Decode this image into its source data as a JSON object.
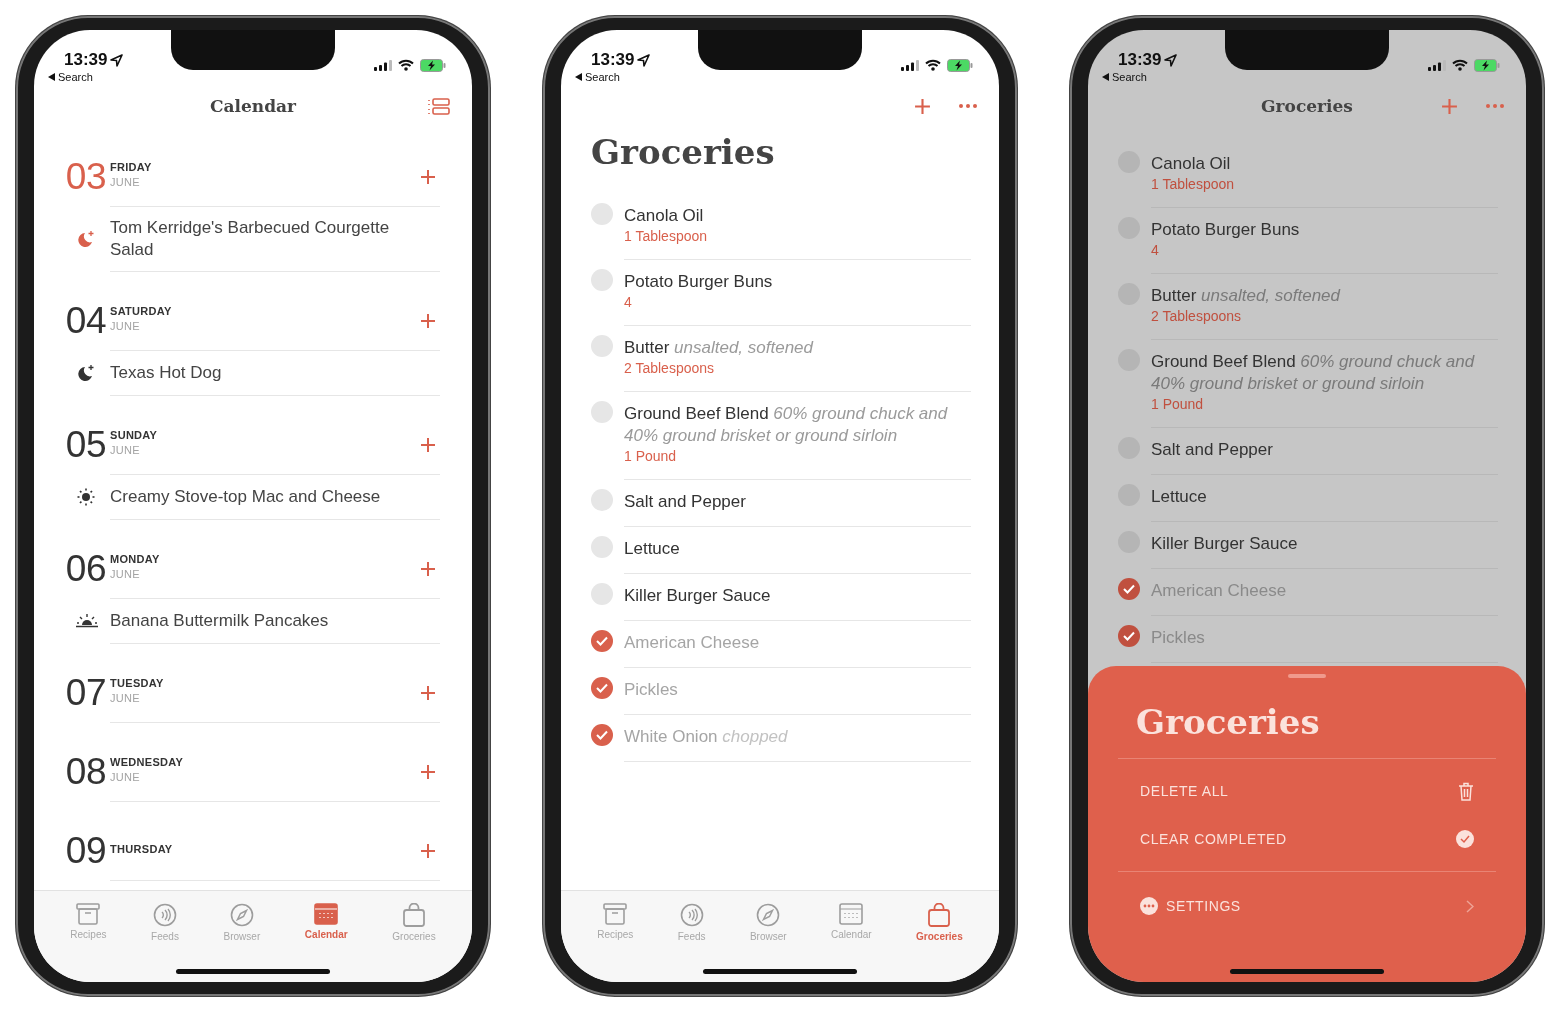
{
  "phones": [
    {
      "kind": "calendar",
      "dimmed": false,
      "status": {
        "time": "13:39",
        "back": "Search"
      },
      "nav": {
        "title": "Calendar"
      },
      "days": [
        {
          "day": "03",
          "weekday": "FRIDAY",
          "month": "JUNE",
          "today": true,
          "meals": [
            {
              "kind": "dinner",
              "title": "Tom Kerridge's Barbecued Courgette Salad"
            }
          ]
        },
        {
          "day": "04",
          "weekday": "SATURDAY",
          "month": "JUNE",
          "today": false,
          "meals": [
            {
              "kind": "dinner",
              "title": "Texas Hot Dog"
            }
          ]
        },
        {
          "day": "05",
          "weekday": "SUNDAY",
          "month": "JUNE",
          "today": false,
          "meals": [
            {
              "kind": "lunch",
              "title": "Creamy Stove-top Mac and Cheese"
            }
          ]
        },
        {
          "day": "06",
          "weekday": "MONDAY",
          "month": "JUNE",
          "today": false,
          "meals": [
            {
              "kind": "breakfast",
              "title": "Banana Buttermilk Pancakes"
            }
          ]
        },
        {
          "day": "07",
          "weekday": "TUESDAY",
          "month": "JUNE",
          "today": false
        },
        {
          "day": "08",
          "weekday": "WEDNESDAY",
          "month": "JUNE",
          "today": false
        },
        {
          "day": "09",
          "weekday": "THURSDAY",
          "today": false
        }
      ],
      "tabs": [
        {
          "kind": "recipes",
          "label": "Recipes",
          "selected": false
        },
        {
          "kind": "feeds",
          "label": "Feeds",
          "selected": false
        },
        {
          "kind": "browser",
          "label": "Browser",
          "selected": false
        },
        {
          "kind": "calendar",
          "label": "Calendar",
          "selected": true
        },
        {
          "kind": "groceries",
          "label": "Groceries",
          "selected": false
        }
      ]
    },
    {
      "kind": "groceries",
      "dimmed": false,
      "status": {
        "time": "13:39",
        "back": "Search"
      },
      "nav": {
        "large_title": "Groceries"
      },
      "items": [
        {
          "text": "Canola Oil",
          "quantity": "1 Tablespoon",
          "checked": false
        },
        {
          "text": "Potato Burger Buns",
          "quantity": "4",
          "checked": false
        },
        {
          "text": "Butter *unsalted, softened*",
          "quantity": "2 Tablespoons",
          "checked": false
        },
        {
          "text": "Ground Beef Blend *60% ground chuck and 40% ground brisket or ground sirloin*",
          "quantity": "1 Pound",
          "checked": false
        },
        {
          "text": "Salt and Pepper",
          "checked": false
        },
        {
          "text": "Lettuce",
          "checked": false
        },
        {
          "text": "Killer Burger Sauce",
          "checked": false
        },
        {
          "text": "American Cheese",
          "checked": true
        },
        {
          "text": "Pickles",
          "checked": true
        },
        {
          "text": "White Onion *chopped*",
          "checked": true
        }
      ],
      "tabs": [
        {
          "kind": "recipes",
          "label": "Recipes",
          "selected": false
        },
        {
          "kind": "feeds",
          "label": "Feeds",
          "selected": false
        },
        {
          "kind": "browser",
          "label": "Browser",
          "selected": false
        },
        {
          "kind": "calendar",
          "label": "Calendar",
          "selected": false
        },
        {
          "kind": "groceries",
          "label": "Groceries",
          "selected": true
        }
      ]
    },
    {
      "kind": "groceries",
      "dimmed": true,
      "status": {
        "time": "13:39",
        "back": "Search"
      },
      "nav": {
        "title": "Groceries"
      },
      "items": [
        {
          "text": "Canola Oil",
          "quantity": "1 Tablespoon",
          "checked": false
        },
        {
          "text": "Potato Burger Buns",
          "quantity": "4",
          "checked": false
        },
        {
          "text": "Butter *unsalted, softened*",
          "quantity": "2 Tablespoons",
          "checked": false
        },
        {
          "text": "Ground Beef Blend *60% ground chuck and 40% ground brisket or ground sirloin*",
          "quantity": "1 Pound",
          "checked": false
        },
        {
          "text": "Salt and Pepper",
          "checked": false
        },
        {
          "text": "Lettuce",
          "checked": false
        },
        {
          "text": "Killer Burger Sauce",
          "checked": false
        },
        {
          "text": "American Cheese",
          "checked": true
        },
        {
          "text": "Pickles",
          "checked": true
        }
      ],
      "sheet": {
        "title": "Groceries",
        "actions": [
          {
            "kind": "delete",
            "label": "DELETE ALL"
          },
          {
            "kind": "clear",
            "label": "CLEAR COMPLETED"
          },
          {
            "kind": "settings",
            "label": "SETTINGS"
          }
        ]
      }
    }
  ]
}
